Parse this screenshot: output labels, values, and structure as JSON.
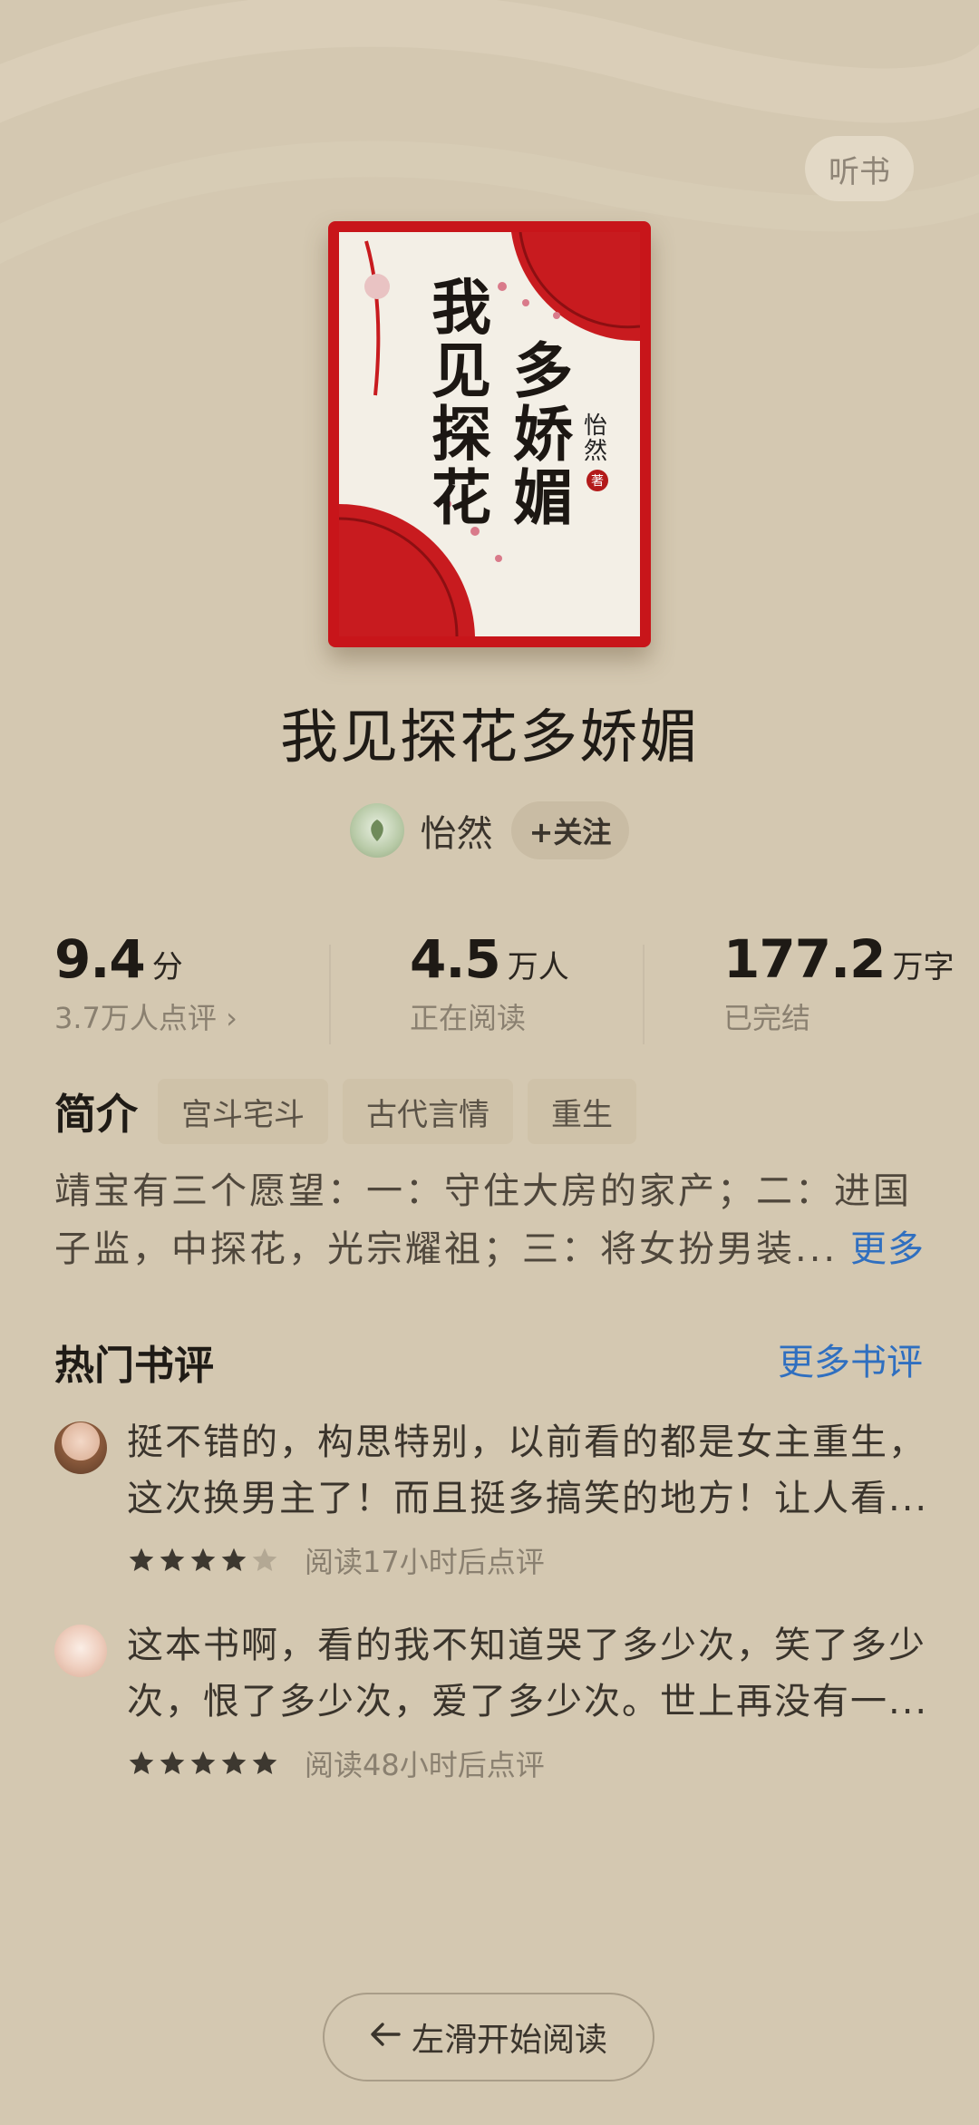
{
  "header": {
    "listen_label": "听书"
  },
  "cover": {
    "title_part1": "我见探花",
    "title_part2": "多娇媚",
    "author": "怡然",
    "seal": "著"
  },
  "book": {
    "title": "我见探花多娇媚"
  },
  "author": {
    "name": "怡然",
    "follow_label": "+关注"
  },
  "stats": {
    "rating": {
      "value": "9.4",
      "unit": "分",
      "sub": "3.7万人点评 ›"
    },
    "readers": {
      "value": "4.5",
      "unit": "万人",
      "sub": "正在阅读"
    },
    "words": {
      "value": "177.2",
      "unit": "万字",
      "sub": "已完结"
    }
  },
  "intro": {
    "label": "简介",
    "tags": [
      "宫斗宅斗",
      "古代言情",
      "重生"
    ],
    "line1": "靖宝有三个愿望：一：守住大房的家产；二：进国",
    "line2": "子监，中探花，光宗耀祖；三：将女扮男装...",
    "more_label": "更多"
  },
  "reviews": {
    "title": "热门书评",
    "more_label": "更多书评",
    "items": [
      {
        "line1": "挺不错的，构思特别，以前看的都是女主重生，",
        "line2": "这次换男主了！而且挺多搞笑的地方！让人看...",
        "stars": 4,
        "meta": "阅读17小时后点评"
      },
      {
        "line1": "这本书啊，看的我不知道哭了多少次，笑了多少",
        "line2": "次，恨了多少次，爱了多少次。世上再没有一...",
        "stars": 5,
        "meta": "阅读48小时后点评"
      }
    ]
  },
  "footer": {
    "start_label": "左滑开始阅读",
    "arrow_icon": "arrow-left-icon"
  },
  "colors": {
    "background": "#d4c8b1",
    "link": "#2f6fc0",
    "cover_red": "#c8151a",
    "star_filled": "#3d3830",
    "star_empty": "#b3a894"
  }
}
